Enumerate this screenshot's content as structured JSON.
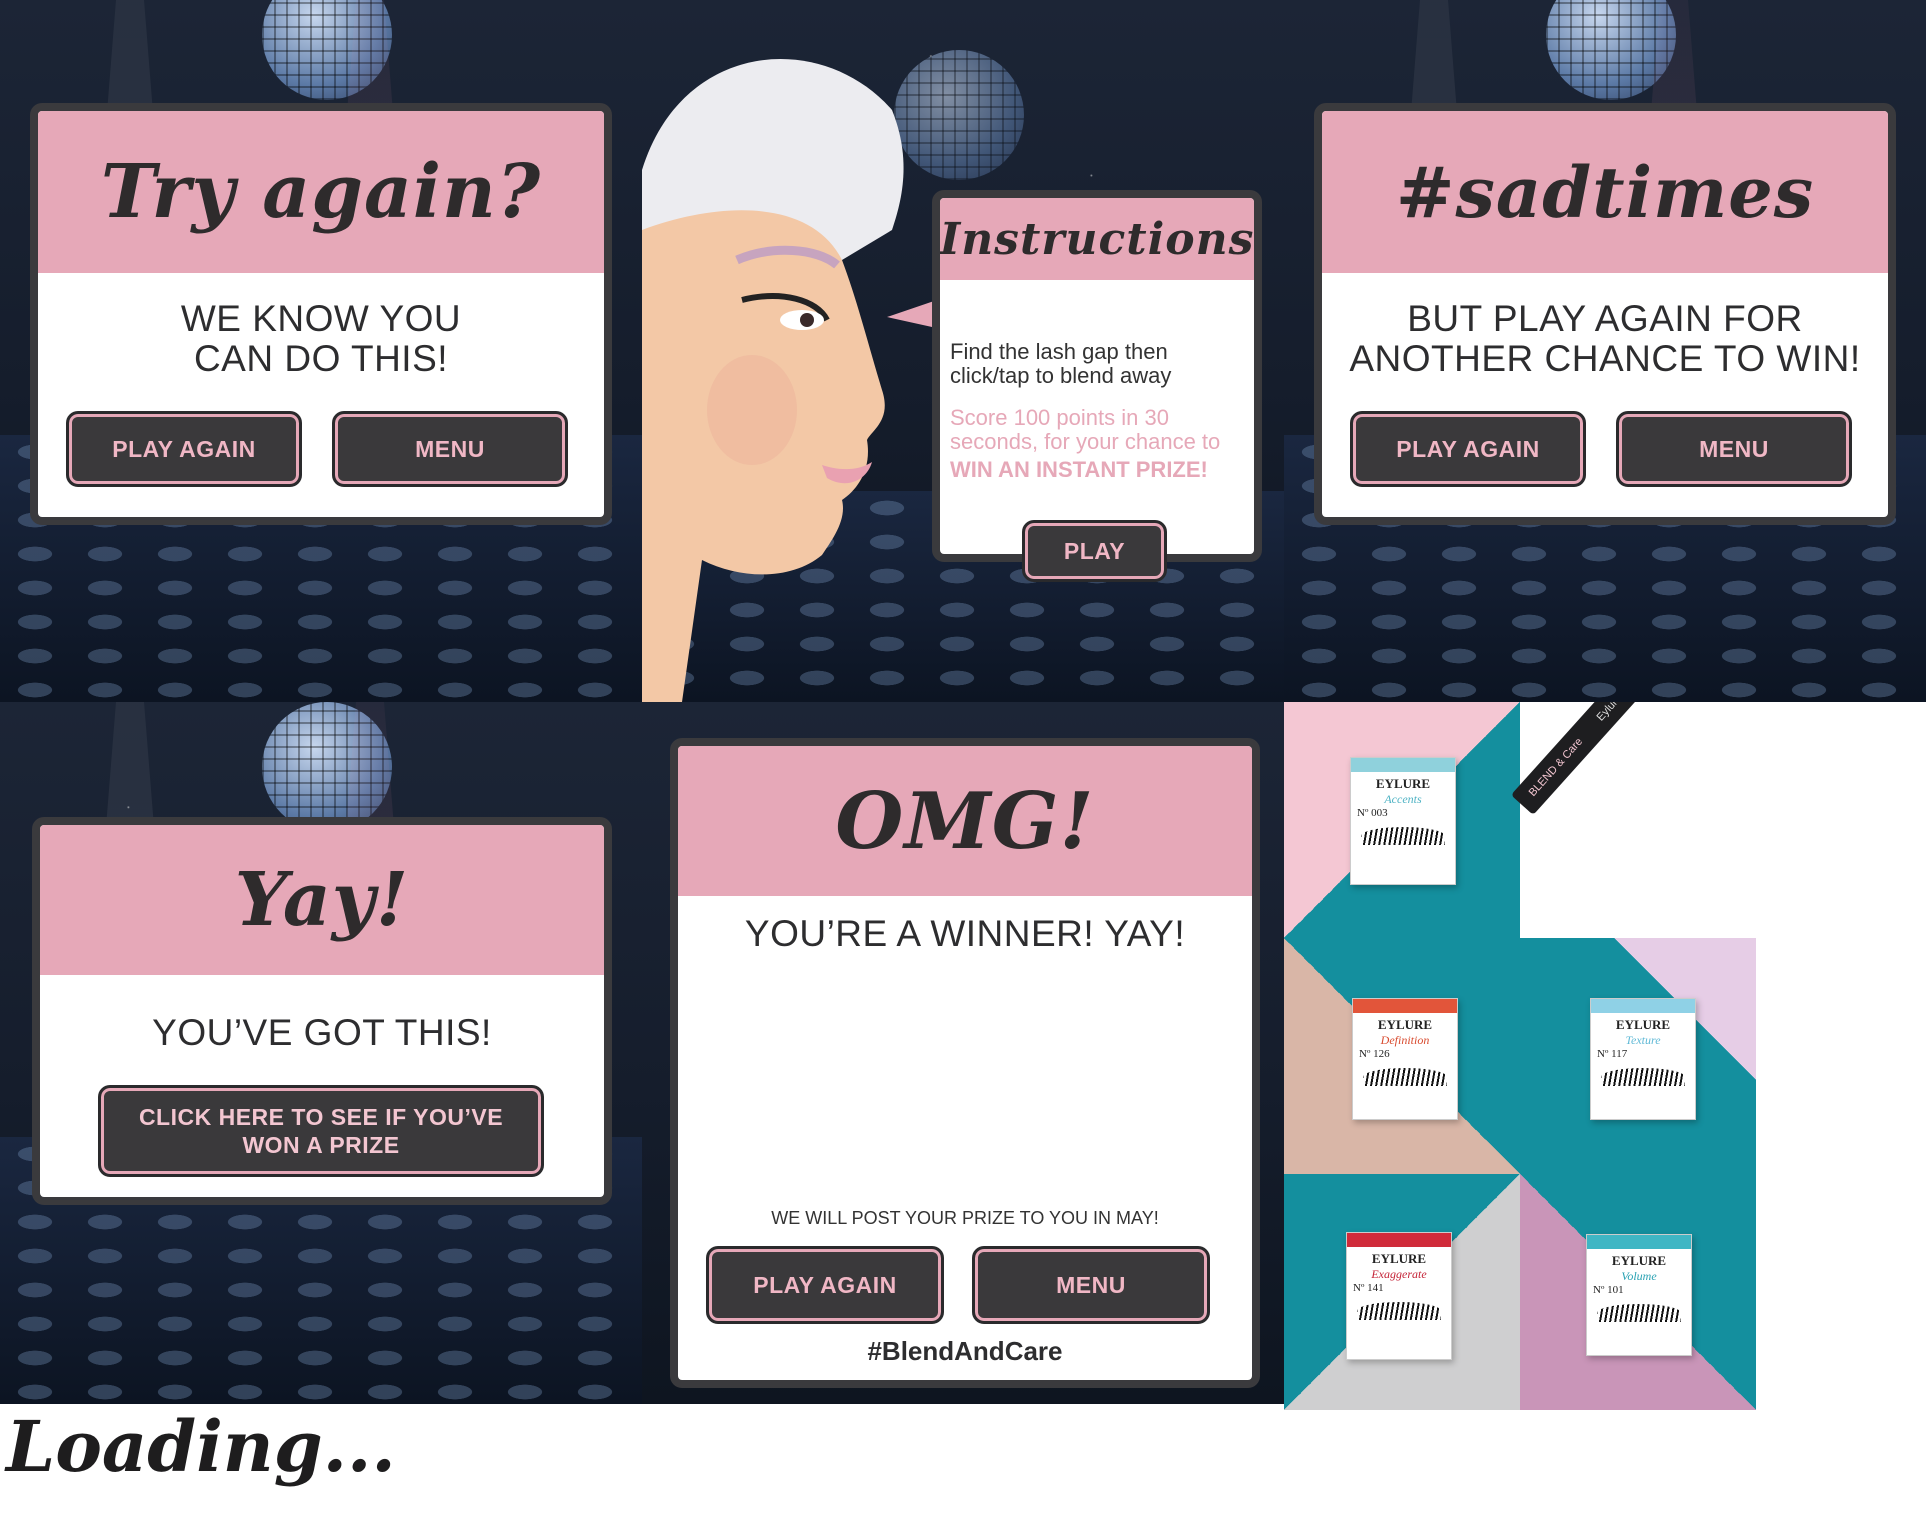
{
  "panels": {
    "try_again": {
      "title": "Try again?",
      "message_line1": "WE KNOW YOU",
      "message_line2": "CAN DO THIS!",
      "play_again": "PLAY AGAIN",
      "menu": "MENU"
    },
    "instructions": {
      "title": "Instructions",
      "body_line1": "Find the lash gap then",
      "body_line2": "click/tap to blend away",
      "score_line1": "Score 100 points in 30",
      "score_line2": "seconds, for your chance to",
      "prize": "WIN AN INSTANT PRIZE!",
      "play": "PLAY"
    },
    "sadtimes": {
      "title": "#sadtimes",
      "message_line1": "BUT PLAY AGAIN FOR",
      "message_line2": "ANOTHER CHANCE TO WIN!",
      "play_again": "PLAY AGAIN",
      "menu": "MENU"
    },
    "yay": {
      "title": "Yay!",
      "message": "YOU’VE GOT THIS!",
      "cta_line1": "CLICK HERE TO SEE IF YOU’VE",
      "cta_line2": "WON A PRIZE"
    },
    "omg": {
      "title": "OMG!",
      "message": "YOU’RE A WINNER!  YAY!",
      "post_note": "WE WILL POST YOUR PRIZE TO YOU IN MAY!",
      "play_again": "PLAY AGAIN",
      "menu": "MENU",
      "hashtag": "#BlendAndCare"
    },
    "products": {
      "items": [
        {
          "brand": "EYLURE",
          "name": "Accents",
          "number": "Nº 003",
          "tab_color": "#8fd1dc",
          "name_color": "#4fb3c4"
        },
        {
          "brand": "EYLURE",
          "name": "Definition",
          "number": "Nº 126",
          "tab_color": "#e2553a",
          "name_color": "#d84a2e"
        },
        {
          "brand": "EYLURE",
          "name": "Texture",
          "number": "Nº 117",
          "tab_color": "#8fd1e6",
          "name_color": "#5fb9d6"
        },
        {
          "brand": "EYLURE",
          "name": "Exaggerate",
          "number": "Nº 141",
          "tab_color": "#d02b3a",
          "name_color": "#c42236"
        },
        {
          "brand": "EYLURE",
          "name": "Volume",
          "number": "Nº 101",
          "tab_color": "#3fb6c4",
          "name_color": "#2aa2b3"
        }
      ],
      "pen_label": "BLEND & Care",
      "pen_brand": "Eylure"
    }
  },
  "loading": "Loading...",
  "colors": {
    "pink": "#e6a8b8",
    "dark": "#3a393b",
    "teal": "#148f9e"
  }
}
